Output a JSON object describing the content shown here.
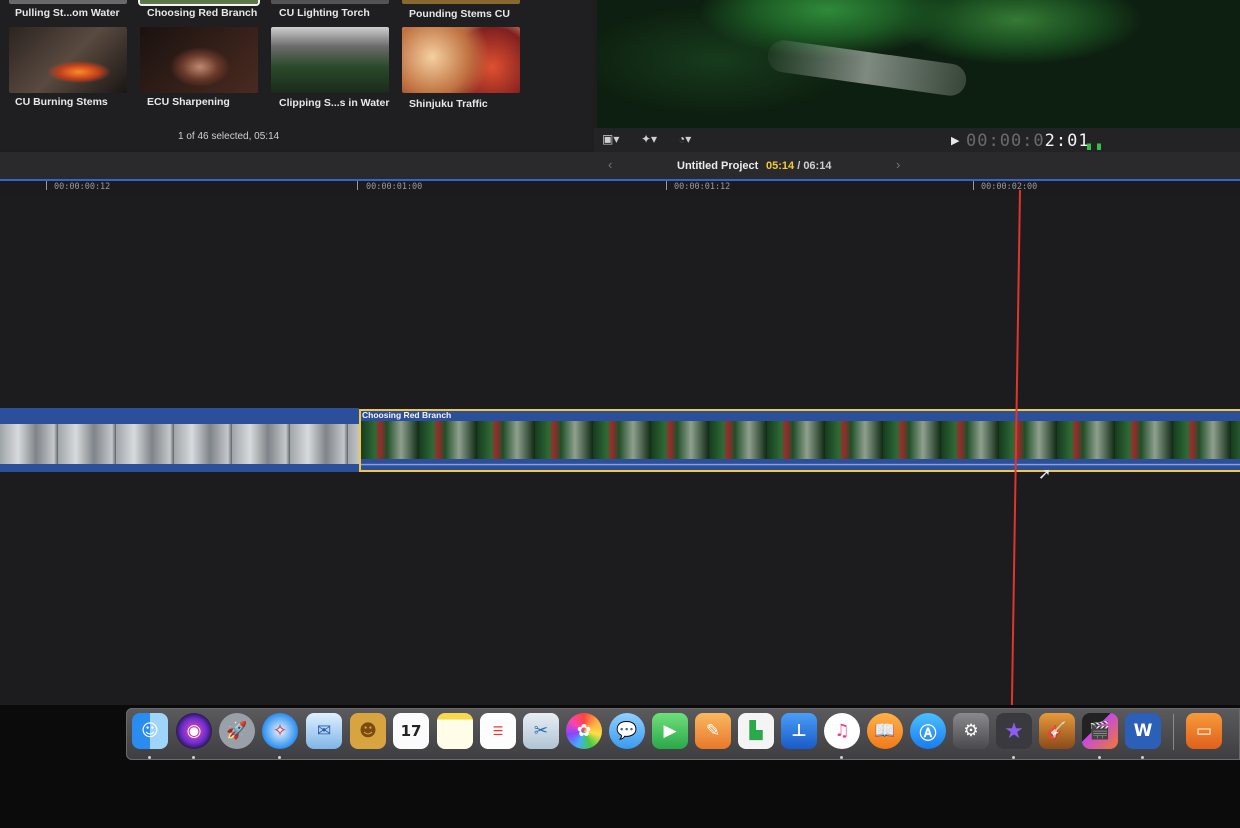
{
  "browser": {
    "clips_row1": [
      "Pulling St...om Water",
      "Choosing Red Branch",
      "CU Lighting Torch",
      "Pounding Stems CU"
    ],
    "clips_row2": [
      "CU Burning Stems",
      "ECU Sharpening",
      "Clipping S...s in Water",
      "Shinjuku Traffic"
    ],
    "status": "1 of 46 selected, 05:14"
  },
  "viewer": {
    "timecode_dim": "00:00:0",
    "timecode_bright": "2:01"
  },
  "project": {
    "name": "Untitled Project",
    "current_time": "05:14",
    "total_time": "/ 06:14"
  },
  "ruler": {
    "ticks": [
      "00:00:00:12",
      "00:00:01:00",
      "00:00:01:12",
      "00:00:02:00"
    ]
  },
  "timeline": {
    "selected_clip_label": "Choosing Red Branch"
  },
  "dock": {
    "apps": [
      "finder",
      "siri",
      "launchpad",
      "safari",
      "mail",
      "contacts",
      "calendar",
      "notes",
      "reminders",
      "preview",
      "photos",
      "messages",
      "facetime",
      "pages",
      "numbers",
      "keynote",
      "itunes",
      "ibooks",
      "app-store",
      "system-preferences",
      "imovie",
      "garageband",
      "final-cut-pro",
      "word",
      "office-folder"
    ],
    "calendar_date": "17"
  },
  "colors": {
    "selection_yellow": "#f2c744",
    "clip_blue": "#2c4f9b",
    "playhead_red": "#e0352b",
    "time_yellow": "#f1cb3b"
  }
}
